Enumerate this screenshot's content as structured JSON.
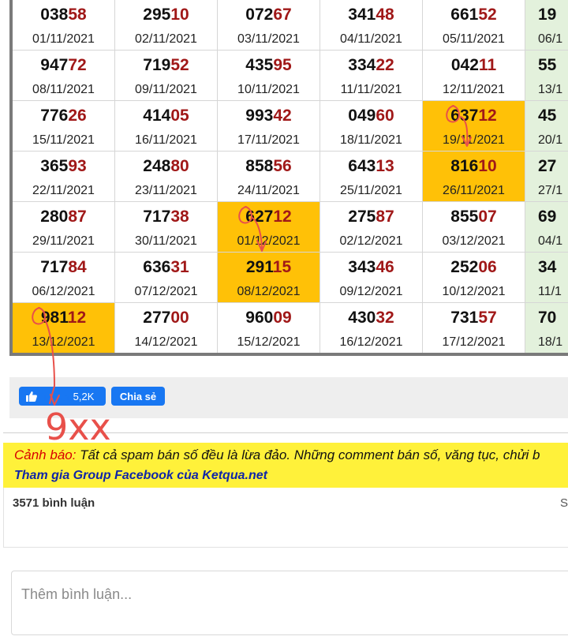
{
  "results": {
    "rows": [
      [
        {
          "head": "038",
          "tail": "58",
          "date": "01/11/2021"
        },
        {
          "head": "295",
          "tail": "10",
          "date": "02/11/2021"
        },
        {
          "head": "072",
          "tail": "67",
          "date": "03/11/2021"
        },
        {
          "head": "341",
          "tail": "48",
          "date": "04/11/2021"
        },
        {
          "head": "661",
          "tail": "52",
          "date": "05/11/2021"
        },
        {
          "head": "19",
          "tail": "",
          "date": "06/1"
        }
      ],
      [
        {
          "head": "947",
          "tail": "72",
          "date": "08/11/2021"
        },
        {
          "head": "719",
          "tail": "52",
          "date": "09/11/2021"
        },
        {
          "head": "435",
          "tail": "95",
          "date": "10/11/2021"
        },
        {
          "head": "334",
          "tail": "22",
          "date": "11/11/2021"
        },
        {
          "head": "042",
          "tail": "11",
          "date": "12/11/2021"
        },
        {
          "head": "55",
          "tail": "",
          "date": "13/1"
        }
      ],
      [
        {
          "head": "776",
          "tail": "26",
          "date": "15/11/2021"
        },
        {
          "head": "414",
          "tail": "05",
          "date": "16/11/2021"
        },
        {
          "head": "993",
          "tail": "42",
          "date": "17/11/2021"
        },
        {
          "head": "049",
          "tail": "60",
          "date": "18/11/2021"
        },
        {
          "head": "637",
          "tail": "12",
          "date": "19/11/2021",
          "hl": true
        },
        {
          "head": "45",
          "tail": "",
          "date": "20/1"
        }
      ],
      [
        {
          "head": "365",
          "tail": "93",
          "date": "22/11/2021"
        },
        {
          "head": "248",
          "tail": "80",
          "date": "23/11/2021"
        },
        {
          "head": "858",
          "tail": "56",
          "date": "24/11/2021"
        },
        {
          "head": "643",
          "tail": "13",
          "date": "25/11/2021"
        },
        {
          "head": "816",
          "tail": "10",
          "date": "26/11/2021",
          "hl": true
        },
        {
          "head": "27",
          "tail": "",
          "date": "27/1"
        }
      ],
      [
        {
          "head": "280",
          "tail": "87",
          "date": "29/11/2021"
        },
        {
          "head": "717",
          "tail": "38",
          "date": "30/11/2021"
        },
        {
          "head": "627",
          "tail": "12",
          "date": "01/12/2021",
          "hl": true
        },
        {
          "head": "275",
          "tail": "87",
          "date": "02/12/2021"
        },
        {
          "head": "855",
          "tail": "07",
          "date": "03/12/2021"
        },
        {
          "head": "69",
          "tail": "",
          "date": "04/1"
        }
      ],
      [
        {
          "head": "717",
          "tail": "84",
          "date": "06/12/2021"
        },
        {
          "head": "636",
          "tail": "31",
          "date": "07/12/2021"
        },
        {
          "head": "291",
          "tail": "15",
          "date": "08/12/2021",
          "hl": true
        },
        {
          "head": "343",
          "tail": "46",
          "date": "09/12/2021"
        },
        {
          "head": "252",
          "tail": "06",
          "date": "10/12/2021"
        },
        {
          "head": "34",
          "tail": "",
          "date": "11/1"
        }
      ],
      [
        {
          "head": "981",
          "tail": "12",
          "date": "13/12/2021",
          "hl": true
        },
        {
          "head": "277",
          "tail": "00",
          "date": "14/12/2021"
        },
        {
          "head": "960",
          "tail": "09",
          "date": "15/12/2021"
        },
        {
          "head": "430",
          "tail": "32",
          "date": "16/12/2021"
        },
        {
          "head": "731",
          "tail": "57",
          "date": "17/12/2021"
        },
        {
          "head": "70",
          "tail": "",
          "date": "18/1"
        }
      ]
    ]
  },
  "share": {
    "like_label": "Thích",
    "like_count": "5,2K",
    "share_label": "Chia sẻ"
  },
  "annotation": {
    "text": "9xx",
    "color": "#e8504a"
  },
  "warning": {
    "label": "Cảnh báo:",
    "message": " Tất cả spam bán số đều là lừa đảo. Những comment bán số, văng tục, chửi b",
    "group_link": "Tham gia Group Facebook của Ketqua.net"
  },
  "comments": {
    "count": "3571 bình luận",
    "sort_label": "S",
    "input_placeholder": "Thêm bình luận..."
  },
  "colors": {
    "highlight": "#ffc107",
    "tail_digits": "#a01818",
    "warning_bg": "#fff13a",
    "facebook_blue": "#1877f2"
  }
}
